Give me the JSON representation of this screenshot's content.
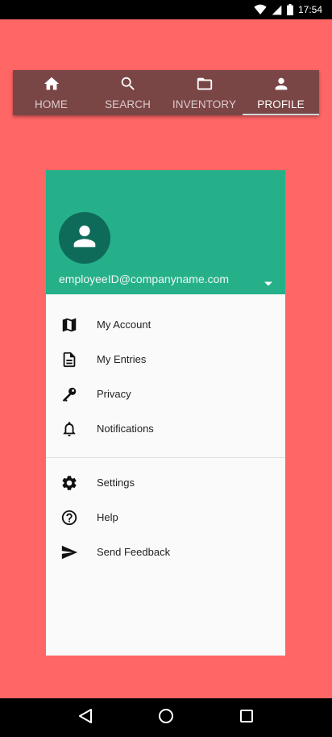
{
  "status_bar": {
    "time": "17:54"
  },
  "tabs": [
    {
      "label": "HOME",
      "icon": "home-icon"
    },
    {
      "label": "SEARCH",
      "icon": "search-icon"
    },
    {
      "label": "INVENTORY",
      "icon": "folder-open-icon"
    },
    {
      "label": "PROFILE",
      "icon": "person-icon",
      "active": true
    }
  ],
  "drawer": {
    "email": "employeeID@companyname.com",
    "primary_items": [
      {
        "label": "My Account",
        "icon": "map-icon"
      },
      {
        "label": "My Entries",
        "icon": "document-icon"
      },
      {
        "label": "Privacy",
        "icon": "key-icon"
      },
      {
        "label": "Notifications",
        "icon": "bell-icon"
      }
    ],
    "secondary_items": [
      {
        "label": "Settings",
        "icon": "gear-icon"
      },
      {
        "label": "Help",
        "icon": "help-circle-icon"
      },
      {
        "label": "Send Feedback",
        "icon": "send-icon"
      }
    ]
  },
  "colors": {
    "background": "#ff6666",
    "tab_bar": "#7a4545",
    "drawer_header": "#26b08a",
    "avatar": "#0e6b5a"
  }
}
